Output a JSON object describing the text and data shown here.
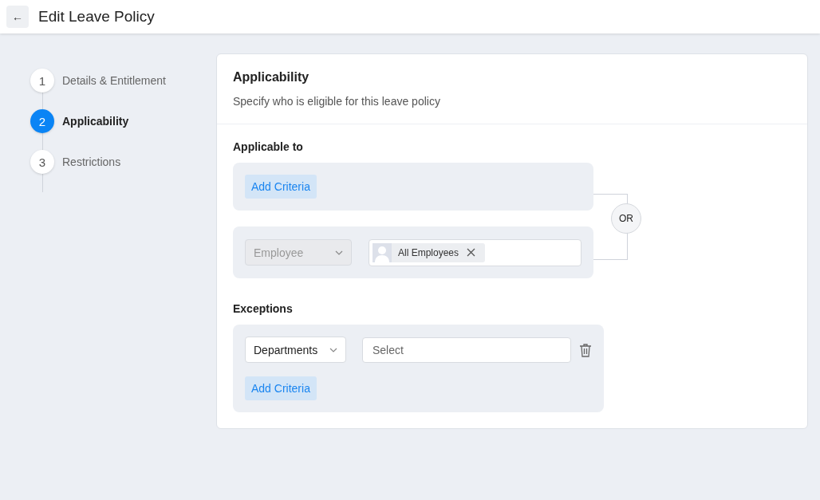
{
  "header": {
    "back_icon": "←",
    "title": "Edit Leave Policy"
  },
  "steps": [
    {
      "number": "1",
      "label": "Details & Entitlement",
      "selected": false
    },
    {
      "number": "2",
      "label": "Applicability",
      "selected": true
    },
    {
      "number": "3",
      "label": "Restrictions",
      "selected": false
    }
  ],
  "card": {
    "title": "Applicability",
    "subtitle": "Specify who is eligible for this leave policy",
    "applicable_to": {
      "label": "Applicable to",
      "add_button": "Add Criteria",
      "connector": "OR",
      "criteria": {
        "field": "Employee",
        "disabled": true,
        "chips": [
          {
            "label": "All Employees"
          }
        ]
      }
    },
    "exceptions": {
      "label": "Exceptions",
      "field": "Departments",
      "disabled": false,
      "placeholder": "Select",
      "add_button": "Add Criteria"
    }
  }
}
